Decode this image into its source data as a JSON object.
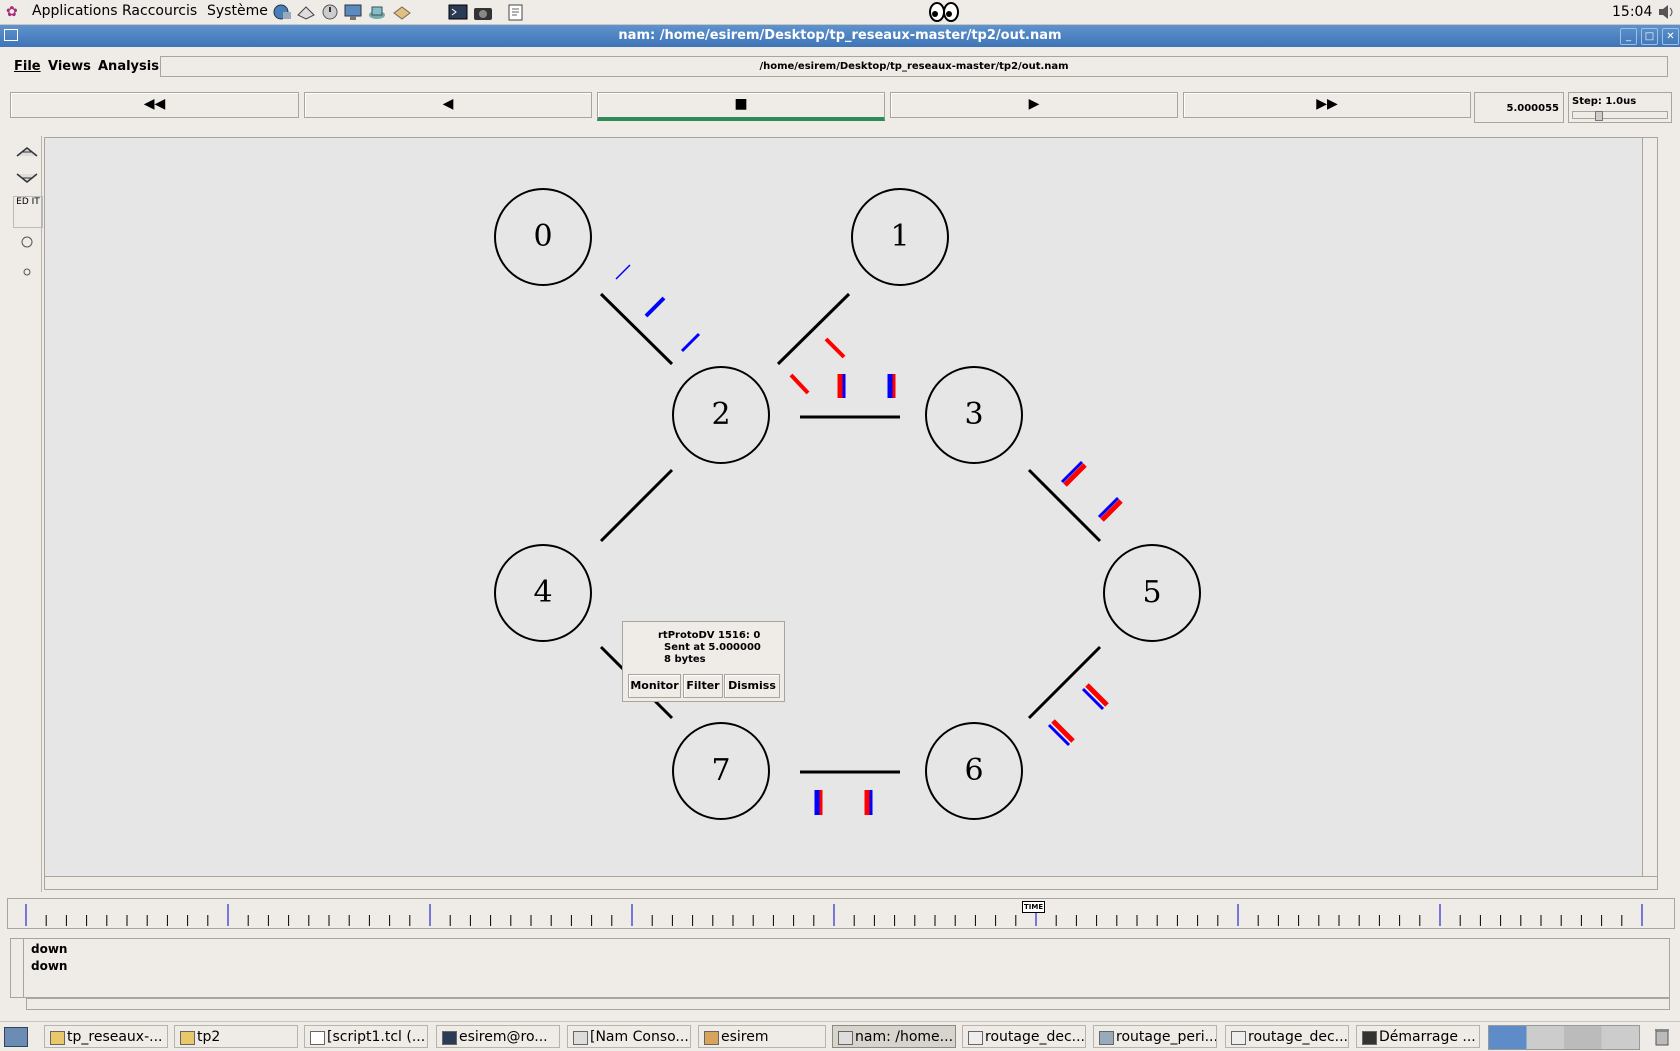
{
  "top_panel": {
    "menus": [
      "Applications",
      "Raccourcis",
      "Système"
    ],
    "clock": "15:04"
  },
  "window": {
    "title": "nam: /home/esirem/Desktop/tp_reseaux-master/tp2/out.nam"
  },
  "menubar": {
    "items": [
      "File",
      "Views",
      "Analysis"
    ],
    "path": "/home/esirem/Desktop/tp_reseaux-master/tp2/out.nam"
  },
  "transport": {
    "rewind": "◀◀",
    "back": "◀",
    "stop": "■",
    "play": "▶",
    "fast_forward": "▶▶",
    "time": "5.000055",
    "step": "Step: 1.0us"
  },
  "tools": {
    "edit": "ED IT"
  },
  "nodes": [
    "0",
    "1",
    "2",
    "3",
    "4",
    "5",
    "6",
    "7"
  ],
  "popup": {
    "line1": "rtProtoDV 1516: 0",
    "line2": "Sent at 5.000000",
    "line3": "8 bytes",
    "monitor": "Monitor",
    "filter": "Filter",
    "dismiss": "Dismiss"
  },
  "timeline": {
    "marker": "TIME"
  },
  "log": {
    "lines": [
      "down",
      "down"
    ]
  },
  "taskbar": {
    "items": [
      "tp_reseaux-...",
      "tp2",
      "[script1.tcl (...",
      "esirem@ro...",
      "[Nam Conso...",
      "esirem",
      "nam: /home...",
      "routage_dec...",
      "routage_peri...",
      "routage_dec...",
      "Démarrage ..."
    ]
  },
  "colors": {
    "packet_red": "#ff0000",
    "packet_blue": "#0000ff",
    "progress_green": "#2e8b57"
  }
}
